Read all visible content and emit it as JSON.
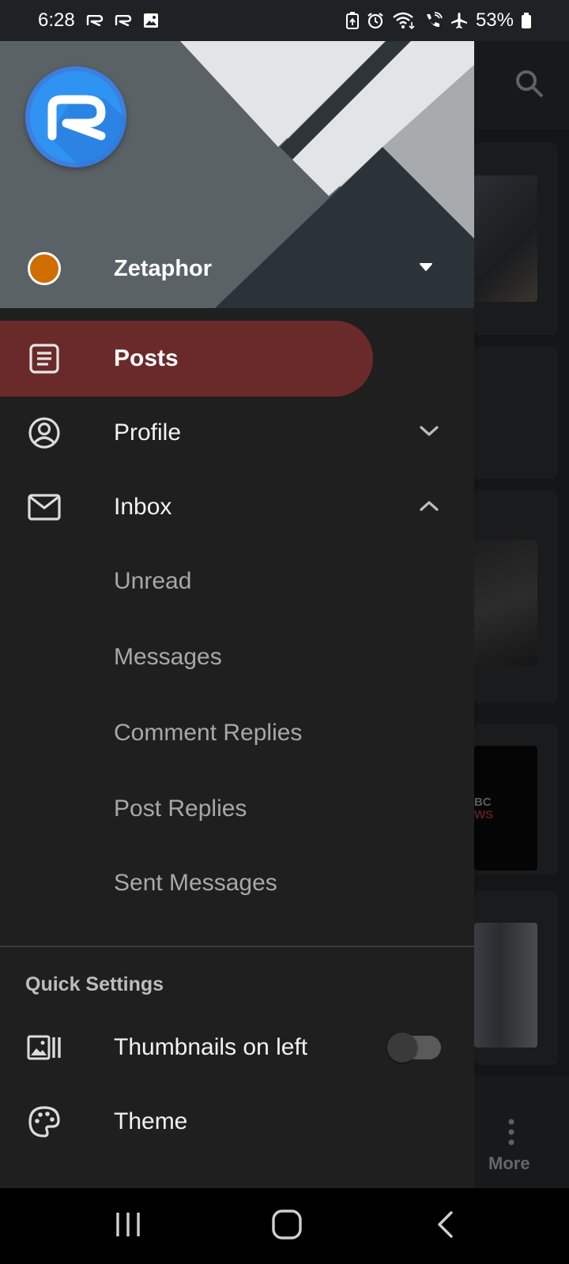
{
  "status_bar": {
    "time": "6:28",
    "left_icons": [
      "reddit-notification-icon",
      "reddit-notification-icon",
      "image-notification-icon"
    ],
    "right_icons": [
      "battery-saver-icon",
      "alarm-icon",
      "wifi-icon",
      "wifi-calling-icon",
      "airplane-mode-icon"
    ],
    "battery": "53%"
  },
  "background": {
    "more_label": "More",
    "bbc_text_line1": "BC",
    "bbc_text_line2": "WS"
  },
  "drawer": {
    "account": {
      "name": "Zetaphor",
      "status_color": "#cf6d00"
    },
    "menu": [
      {
        "label": "Posts",
        "icon": "posts-icon",
        "active": true
      },
      {
        "label": "Profile",
        "icon": "profile-icon",
        "expanded": false
      },
      {
        "label": "Inbox",
        "icon": "inbox-icon",
        "expanded": true
      }
    ],
    "inbox_items": [
      "Unread",
      "Messages",
      "Comment Replies",
      "Post Replies",
      "Sent Messages"
    ],
    "quick_settings": {
      "title": "Quick Settings",
      "thumbnails_label": "Thumbnails on left",
      "thumbnails_enabled": false,
      "theme_label": "Theme"
    }
  },
  "colors": {
    "accent_active": "#6b2a2a",
    "drawer_bg": "#1f1f20",
    "logo_blue": "#2f93f2"
  }
}
